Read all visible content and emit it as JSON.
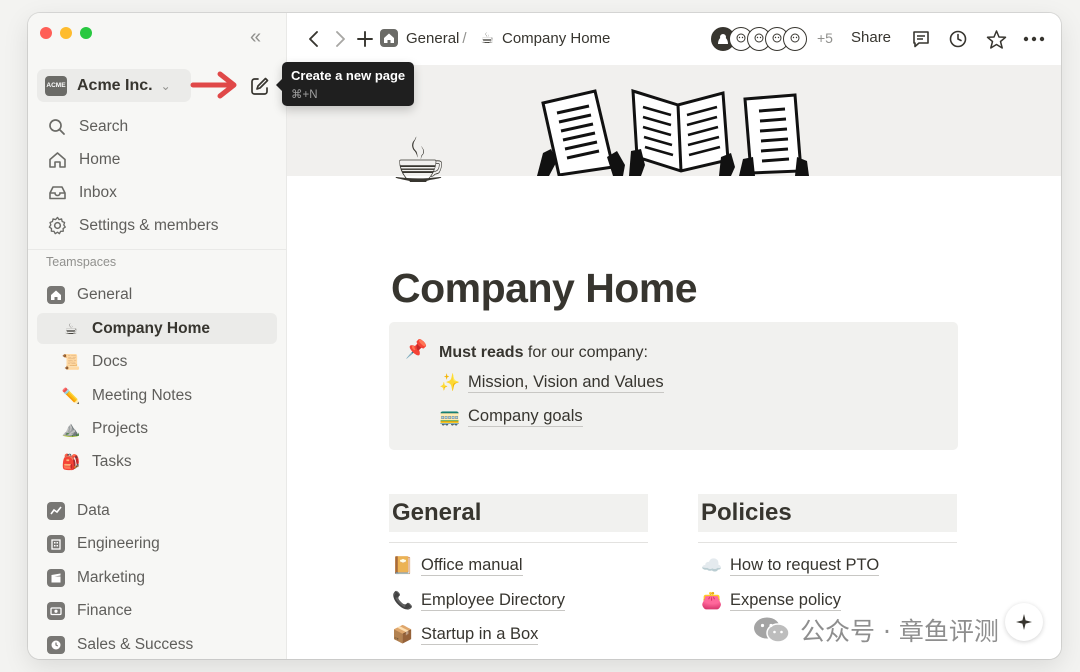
{
  "sidebar": {
    "workspace_name": "Acme Inc.",
    "workspace_logo": "ACME",
    "nav": [
      {
        "label": "Search",
        "icon": "search-icon"
      },
      {
        "label": "Home",
        "icon": "home-icon"
      },
      {
        "label": "Inbox",
        "icon": "inbox-icon"
      },
      {
        "label": "Settings & members",
        "icon": "gear-icon"
      }
    ],
    "teamspaces_label": "Teamspaces",
    "teamspace_items": [
      {
        "label": "General",
        "icon": "house-square-icon",
        "emoji": ""
      },
      {
        "label": "Company Home",
        "icon": "coffee-icon",
        "emoji": "☕"
      },
      {
        "label": "Docs",
        "icon": "scroll-icon",
        "emoji": "📜"
      },
      {
        "label": "Meeting Notes",
        "icon": "pencil-icon",
        "emoji": "✏️"
      },
      {
        "label": "Projects",
        "icon": "mountain-icon",
        "emoji": "⛰️"
      },
      {
        "label": "Tasks",
        "icon": "backpack-icon",
        "emoji": "🎒"
      }
    ],
    "other_teamspaces": [
      {
        "label": "Data",
        "icon": "chart-square-icon"
      },
      {
        "label": "Engineering",
        "icon": "building-square-icon"
      },
      {
        "label": "Marketing",
        "icon": "clapper-square-icon"
      },
      {
        "label": "Finance",
        "icon": "money-square-icon"
      },
      {
        "label": "Sales & Success",
        "icon": "clock-square-icon"
      }
    ]
  },
  "tooltip": {
    "title": "Create a new page",
    "shortcut": "⌘+N"
  },
  "breadcrumb": {
    "parent": "General",
    "separator": "/",
    "current": "Company Home",
    "current_emoji": "☕"
  },
  "topbar": {
    "extra_count": "+5",
    "share_label": "Share"
  },
  "page": {
    "icon_emoji": "☕",
    "title": "Company Home",
    "callout": {
      "emoji": "📌",
      "bold": "Must reads",
      "text": " for our company:",
      "links": [
        {
          "emoji": "✨",
          "label": "Mission, Vision and Values"
        },
        {
          "emoji": "🚃",
          "label": "Company goals"
        }
      ]
    },
    "columns": [
      {
        "heading": "General",
        "links": [
          {
            "emoji": "📔",
            "label": "Office manual"
          },
          {
            "emoji": "📞",
            "label": "Employee Directory"
          },
          {
            "emoji": "📦",
            "label": "Startup in a Box"
          }
        ]
      },
      {
        "heading": "Policies",
        "links": [
          {
            "emoji": "☁️",
            "label": "How to request PTO"
          },
          {
            "emoji": "👛",
            "label": "Expense policy"
          }
        ]
      }
    ]
  },
  "watermark": {
    "text": "公众号 · 章鱼评测"
  }
}
